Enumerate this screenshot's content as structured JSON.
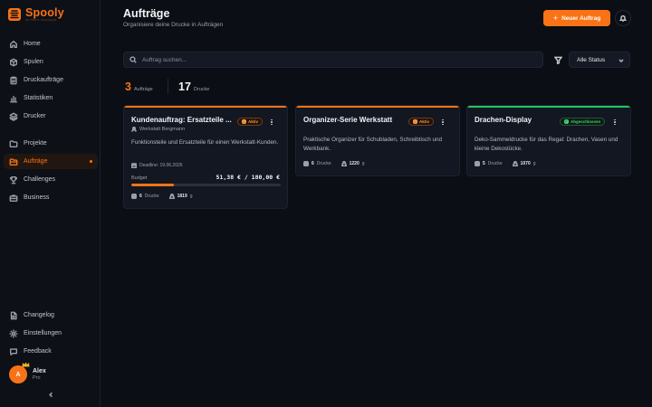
{
  "app": {
    "name": "Spooly",
    "tagline": "3D PRINT MANAGER"
  },
  "colors": {
    "accent": "#f97316",
    "success": "#22c55e",
    "background": "#0b0e14"
  },
  "sidebar": {
    "items": [
      {
        "label": "Home",
        "icon": "home-icon"
      },
      {
        "label": "Spulen",
        "icon": "box-icon"
      },
      {
        "label": "Druckaufträge",
        "icon": "clipboard-icon"
      },
      {
        "label": "Statistiken",
        "icon": "bar-chart-icon"
      },
      {
        "label": "Drucker",
        "icon": "layers-icon"
      },
      {
        "label": "Projekte",
        "icon": "folder-icon"
      },
      {
        "label": "Aufträge",
        "icon": "folder-open-icon",
        "active": true
      },
      {
        "label": "Challenges",
        "icon": "trophy-icon"
      },
      {
        "label": "Business",
        "icon": "briefcase-icon"
      }
    ],
    "footer_items": [
      {
        "label": "Changelog",
        "icon": "file-text-icon"
      },
      {
        "label": "Einstellungen",
        "icon": "settings-icon"
      },
      {
        "label": "Feedback",
        "icon": "message-icon"
      }
    ],
    "user": {
      "initial": "A",
      "name": "Alex",
      "plan": "Pro"
    }
  },
  "header": {
    "title": "Aufträge",
    "subtitle": "Organisiere deine Drucke in Aufträgen",
    "new_button": "Neuer Auftrag"
  },
  "search": {
    "placeholder": "Auftrag suchen...",
    "value": ""
  },
  "filter": {
    "status_value": "Alle Status"
  },
  "stats": {
    "orders_count": "3",
    "orders_label": "Aufträge",
    "prints_count": "17",
    "prints_label": "Drucke"
  },
  "cards": [
    {
      "title": "Kundenauftrag: Ersatzteile ...",
      "status": "Aktiv",
      "customer": "Werkstatt Bergmann",
      "description": "Funktionsteile und Ersatzteile für einen Werkstatt-Kunden.",
      "deadline": "Deadline: 19.06.2026",
      "budget_label": "Budget",
      "budget_value": "51,38 € / 180,00 €",
      "budget_fraction": 0.285,
      "prints": "6",
      "prints_label": "Drucke",
      "weight": "1819",
      "weight_unit": "g"
    },
    {
      "title": "Organizer-Serie Werkstatt",
      "status": "Aktiv",
      "description": "Praktische Organizer für Schubladen, Schreibtisch und Werkbank.",
      "prints": "6",
      "prints_label": "Drucke",
      "weight": "1220",
      "weight_unit": "g"
    },
    {
      "title": "Drachen-Display",
      "status": "Abgeschlossen",
      "description": "Deko-Sammeldrucke für das Regal: Drachen, Vasen und kleine Dekostücke.",
      "prints": "5",
      "prints_label": "Drucke",
      "weight": "1070",
      "weight_unit": "g"
    }
  ]
}
